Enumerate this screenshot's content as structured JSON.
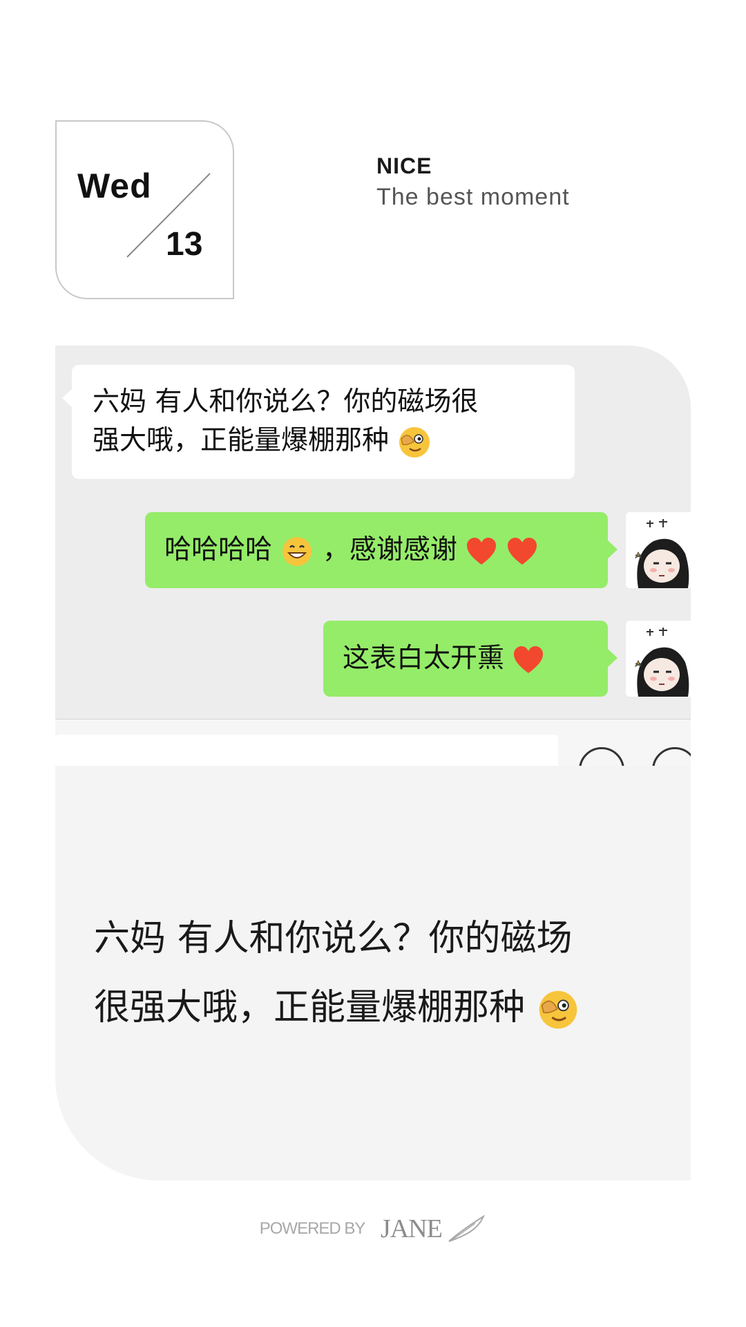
{
  "date": {
    "day": "Wed",
    "number": "13"
  },
  "header": {
    "title": "NICE",
    "subtitle": "The best moment"
  },
  "chat": {
    "messages": [
      {
        "side": "left",
        "text_line1": "六妈 有人和你说么？你的磁场很",
        "text_line2": "强大哦，正能量爆棚那种",
        "emoji": "face-covering-eye-icon"
      },
      {
        "side": "right",
        "text_part1": "哈哈哈哈",
        "emoji1": "grinning-face-icon",
        "text_part2": "，感谢感谢",
        "emoji2": "red-heart-icon"
      },
      {
        "side": "right",
        "text": "这表白太开熏",
        "emoji": "red-heart-icon"
      }
    ]
  },
  "quote": {
    "line1": "六妈 有人和你说么？你的磁场",
    "line2": "很强大哦，正能量爆棚那种",
    "emoji": "face-covering-eye-icon"
  },
  "footer": {
    "powered": "POWERED BY",
    "brand": "JANE"
  },
  "colors": {
    "chat_background": "#ededed",
    "incoming_bubble": "#ffffff",
    "outgoing_bubble": "#95ec69",
    "quote_background": "#f4f4f4",
    "footer_text": "#a8a8a8"
  }
}
